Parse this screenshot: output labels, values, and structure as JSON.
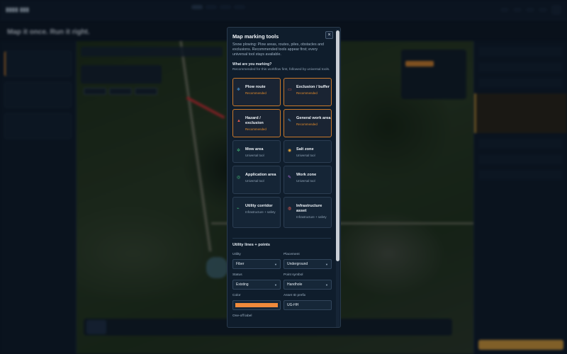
{
  "modal": {
    "title": "Map marking tools",
    "description": "Snow plowing: Plow areas, routes, piles, obstacles and exclusions. Recommended tools appear first; every universal tool stays available.",
    "question": "What are you marking?",
    "hint": "Recommended for this workflow first, followed by universal tools.",
    "close_glyph": "×",
    "tools": [
      {
        "name": "Plow route",
        "sub": "Recommended",
        "recommended": true,
        "icon": "plow-route-icon",
        "glyph": "❄",
        "color": "#4fa3e0"
      },
      {
        "name": "Exclusion / buffer",
        "sub": "Recommended",
        "recommended": true,
        "icon": "exclusion-icon",
        "glyph": "▭",
        "color": "#e05a4f"
      },
      {
        "name": "Hazard / exclusion",
        "sub": "Recommended",
        "recommended": true,
        "icon": "hazard-icon",
        "glyph": "▲",
        "color": "#e05a4f"
      },
      {
        "name": "General work area",
        "sub": "Recommended",
        "recommended": true,
        "icon": "general-area-icon",
        "glyph": "✎",
        "color": "#4fa3e0"
      },
      {
        "name": "Mow area",
        "sub": "Universal tool",
        "recommended": false,
        "icon": "mow-icon",
        "glyph": "✲",
        "color": "#46c27a"
      },
      {
        "name": "Salt zone",
        "sub": "Universal tool",
        "recommended": false,
        "icon": "salt-icon",
        "glyph": "◉",
        "color": "#e3a43a"
      },
      {
        "name": "Application area",
        "sub": "Universal tool",
        "recommended": false,
        "icon": "application-icon",
        "glyph": "◎",
        "color": "#46c27a"
      },
      {
        "name": "Work zone",
        "sub": "Universal tool",
        "recommended": false,
        "icon": "work-zone-icon",
        "glyph": "✎",
        "color": "#b56ee0"
      },
      {
        "name": "Utility corridor",
        "sub": "Infrastructure + safety",
        "recommended": false,
        "icon": "utility-corridor-icon",
        "glyph": "⌁",
        "color": "#46c27a"
      },
      {
        "name": "Infrastructure asset",
        "sub": "Infrastructure + safety",
        "recommended": false,
        "icon": "infrastructure-icon",
        "glyph": "◍",
        "color": "#e05a4f"
      }
    ],
    "utility_section": {
      "title": "Utility lines + points",
      "utility_label": "Utility",
      "utility_value": "Fiber",
      "placement_label": "Placement",
      "placement_value": "Underground",
      "status_label": "Status",
      "status_value": "Existing",
      "symbol_label": "Point symbol",
      "symbol_value": "Handhole",
      "color_label": "Color",
      "color_value": "#f08a3b",
      "prefix_label": "Asset ID prefix",
      "prefix_value": "UG-HH",
      "oneoff_label": "One-off label"
    }
  },
  "background": {
    "headline": "Map it once. Run it right."
  }
}
